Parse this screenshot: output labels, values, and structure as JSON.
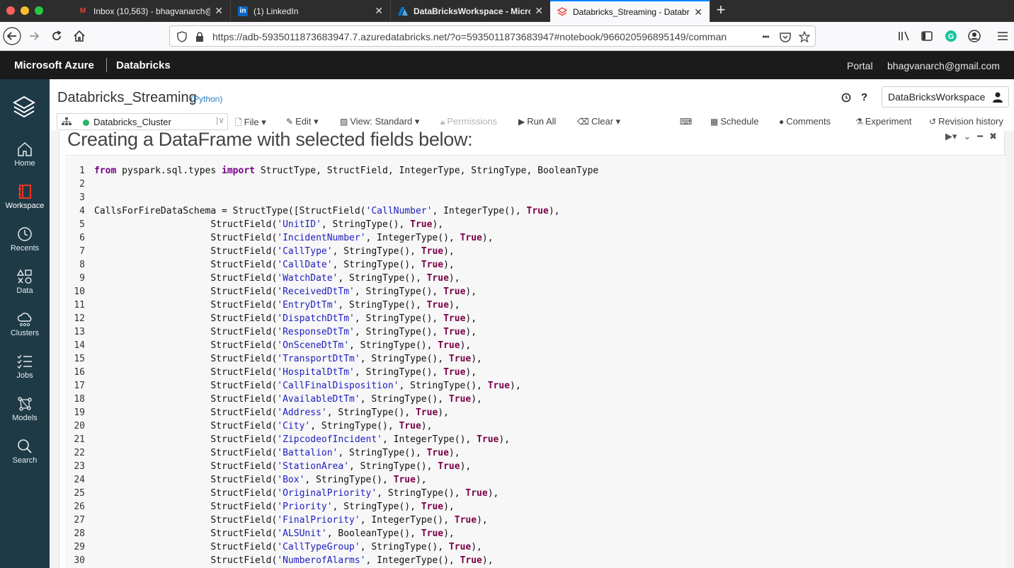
{
  "browser": {
    "tabs": [
      {
        "label": "Inbox (10,563) - bhagvanarch@",
        "icon": "gmail-icon",
        "active": false
      },
      {
        "label": "(1) LinkedIn",
        "icon": "linkedin-icon",
        "active": false
      },
      {
        "label": "DataBricksWorkspace - Microso",
        "icon": "azure-icon",
        "active": false
      },
      {
        "label": "Databricks_Streaming - Databri",
        "icon": "databricks-icon",
        "active": true
      }
    ],
    "new_tab": "+",
    "url": "https://adb-5935011873683947.7.azuredatabricks.net/?o=5935011873683947#notebook/966020596895149/comman",
    "url_more": "•••"
  },
  "azure": {
    "brand": "Microsoft Azure",
    "product": "Databricks",
    "portal": "Portal",
    "user": "bhagvanarch@gmail.com"
  },
  "sidebar": {
    "items": [
      {
        "label": "Home",
        "icon": "home-icon"
      },
      {
        "label": "Workspace",
        "icon": "workspace-icon"
      },
      {
        "label": "Recents",
        "icon": "clock-icon"
      },
      {
        "label": "Data",
        "icon": "data-icon"
      },
      {
        "label": "Clusters",
        "icon": "cloud-icon"
      },
      {
        "label": "Jobs",
        "icon": "jobs-icon"
      },
      {
        "label": "Models",
        "icon": "models-icon"
      },
      {
        "label": "Search",
        "icon": "search-icon"
      }
    ],
    "expand": "›"
  },
  "notebook": {
    "title": "Databricks_Streaming",
    "language": "(Python)",
    "help": "?",
    "workspace_button": "DataBricksWorkspace",
    "cluster": "Databricks_Cluster",
    "menu": {
      "file": "File",
      "edit": "Edit",
      "view": "View: Standard",
      "permissions": "Permissions",
      "run_all": "Run All",
      "clear": "Clear",
      "schedule": "Schedule",
      "comments": "Comments",
      "experiment": "Experiment",
      "revision_history": "Revision history"
    }
  },
  "cell": {
    "heading": "Creating a DataFrame with selected fields below:",
    "code": [
      {
        "n": "1",
        "tokens": [
          [
            "kw",
            "from"
          ],
          [
            "txt",
            " pyspark.sql.types "
          ],
          [
            "kw",
            "import"
          ],
          [
            "txt",
            " StructType, StructField, IntegerType, StringType, BooleanType"
          ]
        ]
      },
      {
        "n": "2",
        "tokens": []
      },
      {
        "n": "3",
        "tokens": []
      },
      {
        "n": "4",
        "tokens": [
          [
            "txt",
            "CallsForFireDataSchema = StructType([StructField("
          ],
          [
            "str",
            "'CallNumber'"
          ],
          [
            "txt",
            ", IntegerType(), "
          ],
          [
            "kw2",
            "True"
          ],
          [
            "txt",
            "),"
          ]
        ]
      },
      {
        "n": "5",
        "tokens": [
          [
            "txt",
            "                     StructField("
          ],
          [
            "str",
            "'UnitID'"
          ],
          [
            "txt",
            ", StringType(), "
          ],
          [
            "kw2",
            "True"
          ],
          [
            "txt",
            "),"
          ]
        ]
      },
      {
        "n": "6",
        "tokens": [
          [
            "txt",
            "                     StructField("
          ],
          [
            "str",
            "'IncidentNumber'"
          ],
          [
            "txt",
            ", IntegerType(), "
          ],
          [
            "kw2",
            "True"
          ],
          [
            "txt",
            "),"
          ]
        ]
      },
      {
        "n": "7",
        "tokens": [
          [
            "txt",
            "                     StructField("
          ],
          [
            "str",
            "'CallType'"
          ],
          [
            "txt",
            ", StringType(), "
          ],
          [
            "kw2",
            "True"
          ],
          [
            "txt",
            "),"
          ]
        ]
      },
      {
        "n": "8",
        "tokens": [
          [
            "txt",
            "                     StructField("
          ],
          [
            "str",
            "'CallDate'"
          ],
          [
            "txt",
            ", StringType(), "
          ],
          [
            "kw2",
            "True"
          ],
          [
            "txt",
            "),"
          ]
        ]
      },
      {
        "n": "9",
        "tokens": [
          [
            "txt",
            "                     StructField("
          ],
          [
            "str",
            "'WatchDate'"
          ],
          [
            "txt",
            ", StringType(), "
          ],
          [
            "kw2",
            "True"
          ],
          [
            "txt",
            "),"
          ]
        ]
      },
      {
        "n": "10",
        "tokens": [
          [
            "txt",
            "                     StructField("
          ],
          [
            "str",
            "'ReceivedDtTm'"
          ],
          [
            "txt",
            ", StringType(), "
          ],
          [
            "kw2",
            "True"
          ],
          [
            "txt",
            "),"
          ]
        ]
      },
      {
        "n": "11",
        "tokens": [
          [
            "txt",
            "                     StructField("
          ],
          [
            "str",
            "'EntryDtTm'"
          ],
          [
            "txt",
            ", StringType(), "
          ],
          [
            "kw2",
            "True"
          ],
          [
            "txt",
            "),"
          ]
        ]
      },
      {
        "n": "12",
        "tokens": [
          [
            "txt",
            "                     StructField("
          ],
          [
            "str",
            "'DispatchDtTm'"
          ],
          [
            "txt",
            ", StringType(), "
          ],
          [
            "kw2",
            "True"
          ],
          [
            "txt",
            "),"
          ]
        ]
      },
      {
        "n": "13",
        "tokens": [
          [
            "txt",
            "                     StructField("
          ],
          [
            "str",
            "'ResponseDtTm'"
          ],
          [
            "txt",
            ", StringType(), "
          ],
          [
            "kw2",
            "True"
          ],
          [
            "txt",
            "),"
          ]
        ]
      },
      {
        "n": "14",
        "tokens": [
          [
            "txt",
            "                     StructField("
          ],
          [
            "str",
            "'OnSceneDtTm'"
          ],
          [
            "txt",
            ", StringType(), "
          ],
          [
            "kw2",
            "True"
          ],
          [
            "txt",
            "),"
          ]
        ]
      },
      {
        "n": "15",
        "tokens": [
          [
            "txt",
            "                     StructField("
          ],
          [
            "str",
            "'TransportDtTm'"
          ],
          [
            "txt",
            ", StringType(), "
          ],
          [
            "kw2",
            "True"
          ],
          [
            "txt",
            "),"
          ]
        ]
      },
      {
        "n": "16",
        "tokens": [
          [
            "txt",
            "                     StructField("
          ],
          [
            "str",
            "'HospitalDtTm'"
          ],
          [
            "txt",
            ", StringType(), "
          ],
          [
            "kw2",
            "True"
          ],
          [
            "txt",
            "),"
          ]
        ]
      },
      {
        "n": "17",
        "tokens": [
          [
            "txt",
            "                     StructField("
          ],
          [
            "str",
            "'CallFinalDisposition'"
          ],
          [
            "txt",
            ", StringType(), "
          ],
          [
            "kw2",
            "True"
          ],
          [
            "txt",
            "),"
          ]
        ]
      },
      {
        "n": "18",
        "tokens": [
          [
            "txt",
            "                     StructField("
          ],
          [
            "str",
            "'AvailableDtTm'"
          ],
          [
            "txt",
            ", StringType(), "
          ],
          [
            "kw2",
            "True"
          ],
          [
            "txt",
            "),"
          ]
        ]
      },
      {
        "n": "19",
        "tokens": [
          [
            "txt",
            "                     StructField("
          ],
          [
            "str",
            "'Address'"
          ],
          [
            "txt",
            ", StringType(), "
          ],
          [
            "kw2",
            "True"
          ],
          [
            "txt",
            "),"
          ]
        ]
      },
      {
        "n": "20",
        "tokens": [
          [
            "txt",
            "                     StructField("
          ],
          [
            "str",
            "'City'"
          ],
          [
            "txt",
            ", StringType(), "
          ],
          [
            "kw2",
            "True"
          ],
          [
            "txt",
            "),"
          ]
        ]
      },
      {
        "n": "21",
        "tokens": [
          [
            "txt",
            "                     StructField("
          ],
          [
            "str",
            "'ZipcodeofIncident'"
          ],
          [
            "txt",
            ", IntegerType(), "
          ],
          [
            "kw2",
            "True"
          ],
          [
            "txt",
            "),"
          ]
        ]
      },
      {
        "n": "22",
        "tokens": [
          [
            "txt",
            "                     StructField("
          ],
          [
            "str",
            "'Battalion'"
          ],
          [
            "txt",
            ", StringType(), "
          ],
          [
            "kw2",
            "True"
          ],
          [
            "txt",
            "),"
          ]
        ]
      },
      {
        "n": "23",
        "tokens": [
          [
            "txt",
            "                     StructField("
          ],
          [
            "str",
            "'StationArea'"
          ],
          [
            "txt",
            ", StringType(), "
          ],
          [
            "kw2",
            "True"
          ],
          [
            "txt",
            "),"
          ]
        ]
      },
      {
        "n": "24",
        "tokens": [
          [
            "txt",
            "                     StructField("
          ],
          [
            "str",
            "'Box'"
          ],
          [
            "txt",
            ", StringType(), "
          ],
          [
            "kw2",
            "True"
          ],
          [
            "txt",
            "),"
          ]
        ]
      },
      {
        "n": "25",
        "tokens": [
          [
            "txt",
            "                     StructField("
          ],
          [
            "str",
            "'OriginalPriority'"
          ],
          [
            "txt",
            ", StringType(), "
          ],
          [
            "kw2",
            "True"
          ],
          [
            "txt",
            "),"
          ]
        ]
      },
      {
        "n": "26",
        "tokens": [
          [
            "txt",
            "                     StructField("
          ],
          [
            "str",
            "'Priority'"
          ],
          [
            "txt",
            ", StringType(), "
          ],
          [
            "kw2",
            "True"
          ],
          [
            "txt",
            "),"
          ]
        ]
      },
      {
        "n": "27",
        "tokens": [
          [
            "txt",
            "                     StructField("
          ],
          [
            "str",
            "'FinalPriority'"
          ],
          [
            "txt",
            ", IntegerType(), "
          ],
          [
            "kw2",
            "True"
          ],
          [
            "txt",
            "),"
          ]
        ]
      },
      {
        "n": "28",
        "tokens": [
          [
            "txt",
            "                     StructField("
          ],
          [
            "str",
            "'ALSUnit'"
          ],
          [
            "txt",
            ", BooleanType(), "
          ],
          [
            "kw2",
            "True"
          ],
          [
            "txt",
            "),"
          ]
        ]
      },
      {
        "n": "29",
        "tokens": [
          [
            "txt",
            "                     StructField("
          ],
          [
            "str",
            "'CallTypeGroup'"
          ],
          [
            "txt",
            ", StringType(), "
          ],
          [
            "kw2",
            "True"
          ],
          [
            "txt",
            "),"
          ]
        ]
      },
      {
        "n": "30",
        "tokens": [
          [
            "txt",
            "                     StructField("
          ],
          [
            "str",
            "'NumberofAlarms'"
          ],
          [
            "txt",
            ", IntegerType(), "
          ],
          [
            "kw2",
            "True"
          ],
          [
            "txt",
            "),"
          ]
        ]
      }
    ]
  }
}
